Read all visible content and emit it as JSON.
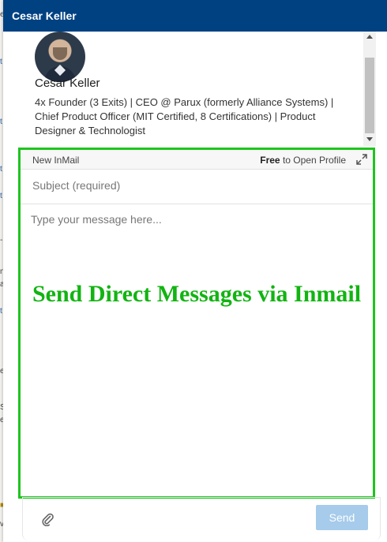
{
  "header": {
    "title": "Cesar Keller"
  },
  "profile": {
    "name": "Cesar Keller",
    "headline": "4x Founder (3 Exits) | CEO @ Parux (formerly Alliance Systems) | Chief Product Officer (MIT Certified, 8 Certifications) | Product Designer & Technologist",
    "avatar_icon": "profile-photo"
  },
  "compose": {
    "type_label": "New InMail",
    "free_bold": "Free",
    "free_rest": " to Open Profile",
    "expand_icon": "expand-icon",
    "subject_placeholder": "Subject (required)",
    "message_placeholder": "Type your message here...",
    "overlay_caption": "Send Direct Messages via Inmail",
    "highlight_color": "#1fc41f"
  },
  "footer": {
    "attach_icon": "paperclip-icon",
    "send_label": "Send"
  },
  "colors": {
    "header_bg": "#004182",
    "send_disabled": "#a6cbeb",
    "caption_green": "#12b412"
  }
}
